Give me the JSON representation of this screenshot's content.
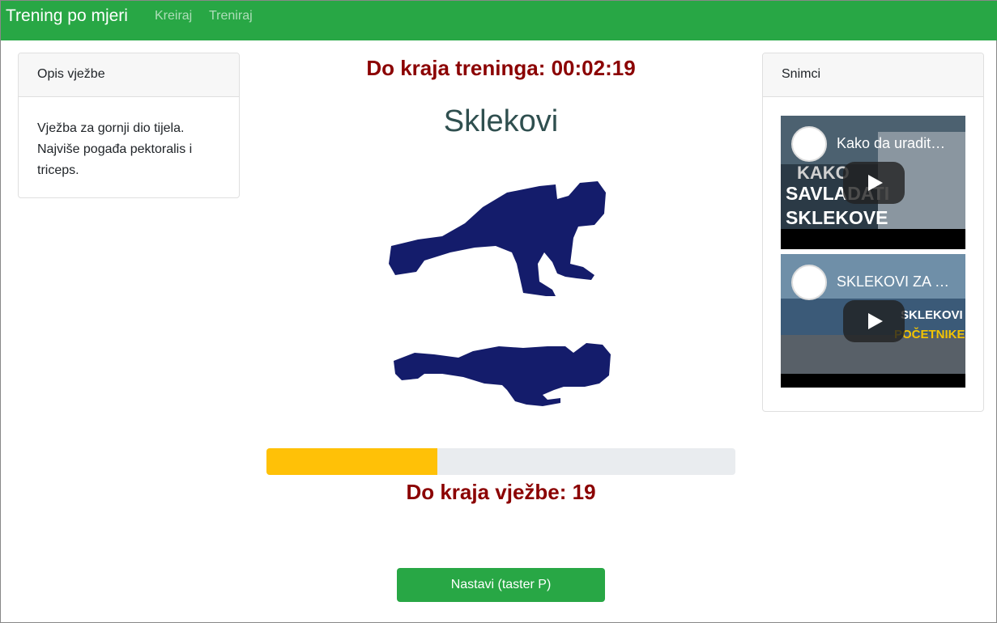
{
  "navbar": {
    "brand": "Trening po mjeri",
    "links": [
      "Kreiraj",
      "Treniraj"
    ],
    "color": "#28a745"
  },
  "description": {
    "header": "Opis vježbe",
    "text": "Vježba za gornji dio tijela. Najviše pogađa pektoralis i triceps."
  },
  "videos": {
    "header": "Snimci",
    "items": [
      {
        "title": "Kako da uradit…",
        "thumb_text": [
          "KAKO",
          "SAVLADATI",
          "SKLEKOVE"
        ]
      },
      {
        "title": "SKLEKOVI ZA …",
        "thumb_text": [
          "SKLEKOVI ZA",
          "POČETNIKE"
        ]
      }
    ]
  },
  "timer": "Do kraja treninga: 00:02:19",
  "exercise": {
    "name": "Sklekovi",
    "figure_icon": "push-up-figure",
    "figure_color": "#141c6b"
  },
  "progress": {
    "fraction": 0.365,
    "color": "#ffc107"
  },
  "remaining": "Do kraja vježbe: 19",
  "button": {
    "label": "Nastavi (taster P)"
  }
}
